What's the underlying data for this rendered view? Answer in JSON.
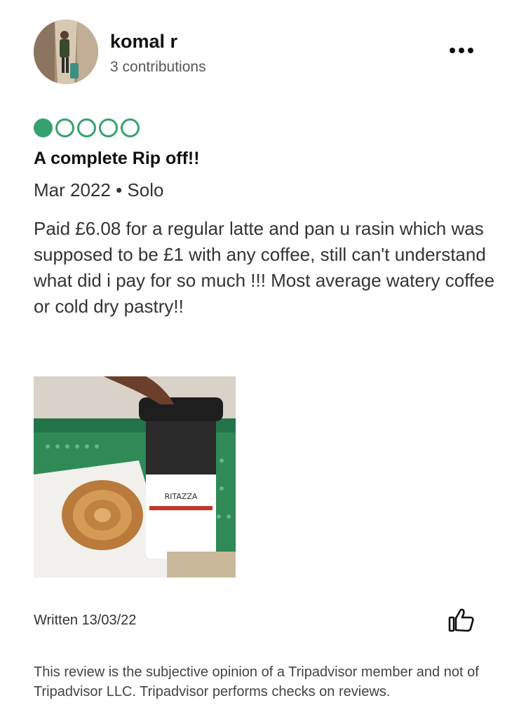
{
  "reviewer": {
    "name": "komal r",
    "contributions": "3 contributions"
  },
  "rating": {
    "value": 1,
    "max": 5,
    "accent_color": "#34a26e"
  },
  "review": {
    "title": "A complete Rip off!!",
    "meta": "Mar 2022 • Solo",
    "text": "Paid £6.08 for a regular latte and pan u rasin which was supposed to be £1 with any coffee, still can't understand what did i pay for so much !!! Most average watery coffee or cold dry pastry!!",
    "photo_cup_brand": "RITAZZA",
    "written": "Written 13/03/22"
  },
  "icons": {
    "more": "more-horizontal-icon",
    "like": "thumbs-up-icon"
  },
  "footer": {
    "disclaimer": "This review is the subjective opinion of a Tripadvisor member and not of Tripadvisor LLC. Tripadvisor performs checks on reviews."
  }
}
